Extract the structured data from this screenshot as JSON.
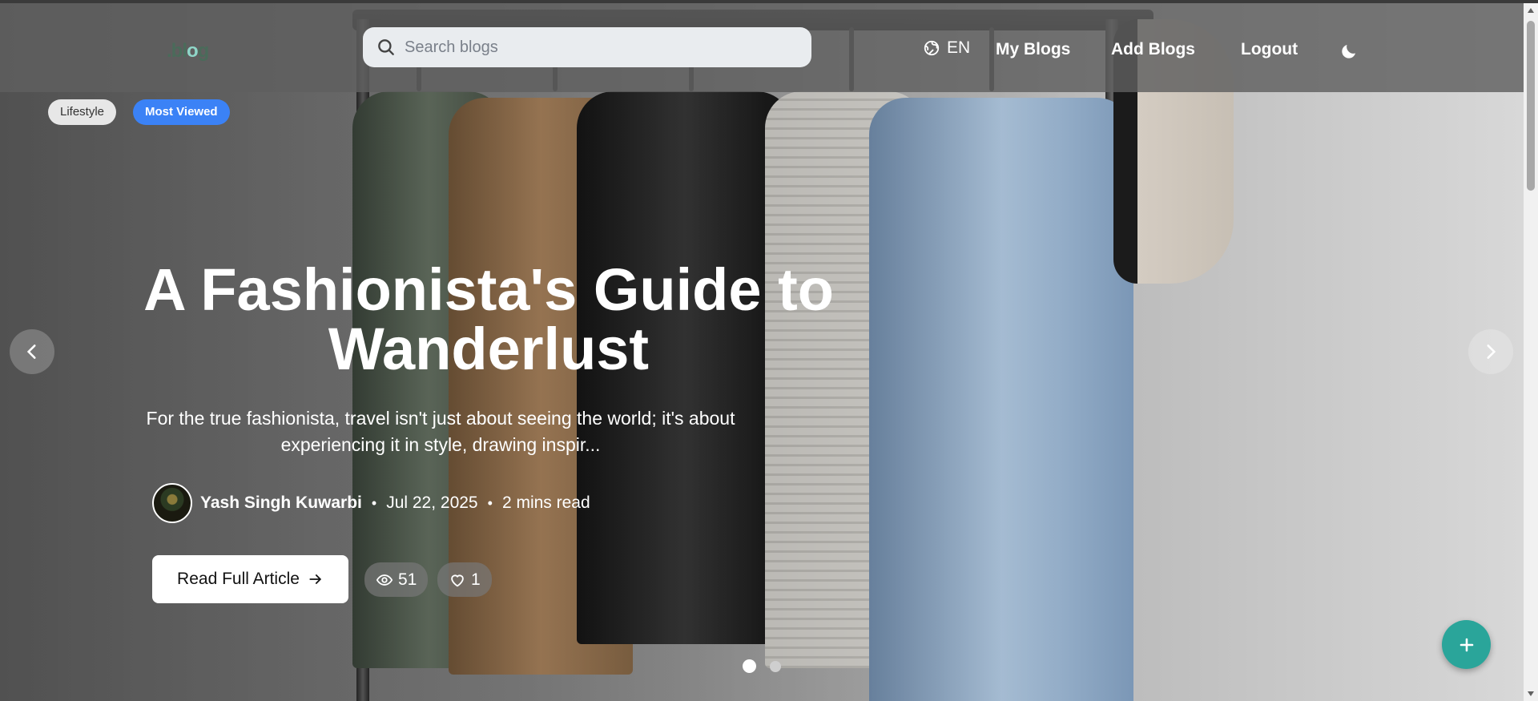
{
  "nav": {
    "logo": {
      "prefix": ".bl",
      "dot": "o",
      "suffix": "g"
    },
    "search_placeholder": "Search blogs",
    "lang": "EN",
    "links": [
      "My Blogs",
      "Add Blogs",
      "Logout"
    ]
  },
  "tags": [
    "Lifestyle",
    "Most Viewed"
  ],
  "post": {
    "title": "A Fashionista's Guide to Wanderlust",
    "excerpt": "For the true fashionista, travel isn't just about seeing the world; it's about experiencing it in style, drawing inspir...",
    "author": "Yash Singh Kuwarbi",
    "date": "Jul 22, 2025",
    "read_time": "2 mins read",
    "cta": "Read Full Article",
    "views": "51",
    "likes": "1"
  },
  "carousel": {
    "slides": 2,
    "active": 1
  },
  "colors": {
    "accent": "#3b82f6",
    "fab": "#2aa59a"
  }
}
